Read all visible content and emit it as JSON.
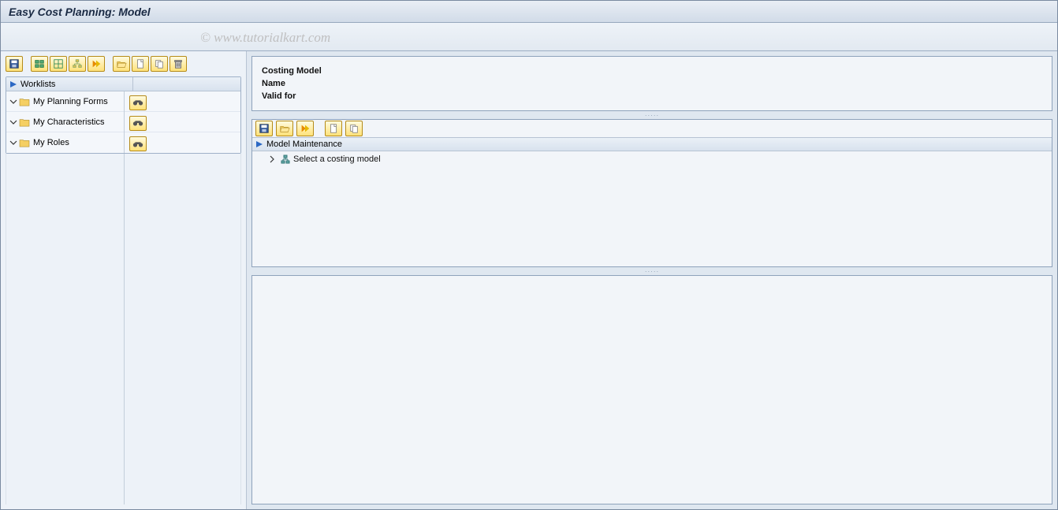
{
  "title": "Easy Cost Planning: Model",
  "watermark": "© www.tutorialkart.com",
  "left_toolbar_icons": [
    "save",
    "graph1",
    "graph2",
    "hierarchy",
    "forward",
    "open",
    "new",
    "copy",
    "delete"
  ],
  "worklists": {
    "header": "Worklists",
    "items": [
      {
        "label": "My Planning Forms"
      },
      {
        "label": "My Characteristics"
      },
      {
        "label": "My Roles"
      }
    ]
  },
  "top_panel": {
    "row1": "Costing Model",
    "row2": "Name",
    "row3": "Valid for"
  },
  "mid_toolbar_icons": [
    "save",
    "open",
    "forward",
    "new",
    "copy"
  ],
  "mid_panel": {
    "header": "Model Maintenance",
    "tree_item": "Select a costing model"
  }
}
